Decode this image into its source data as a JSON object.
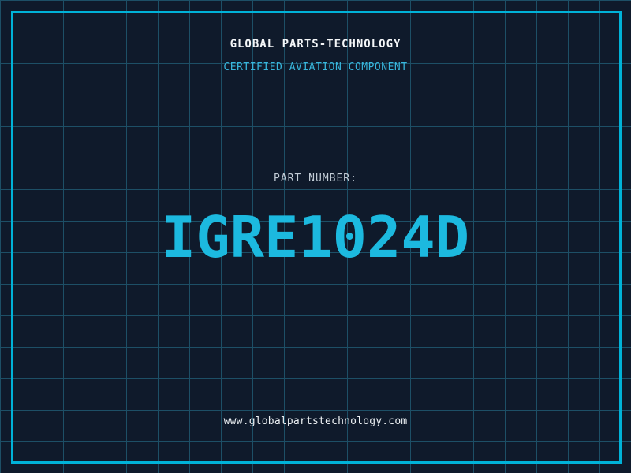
{
  "header": {
    "company_name": "GLOBAL PARTS-TECHNOLOGY",
    "tagline": "CERTIFIED AVIATION COMPONENT"
  },
  "part": {
    "label": "PART NUMBER:",
    "number": "IGRE1024D"
  },
  "footer": {
    "website": "www.globalpartstechnology.com"
  },
  "colors": {
    "background": "#0f1a2b",
    "grid_line": "#1d4f66",
    "frame_border": "#00b2d8",
    "title_text": "#f4f6f8",
    "tagline_text": "#38b6dc",
    "part_label_text": "#c2ccd6",
    "part_number_text": "#1cb9df",
    "website_text": "#eef2f5"
  }
}
